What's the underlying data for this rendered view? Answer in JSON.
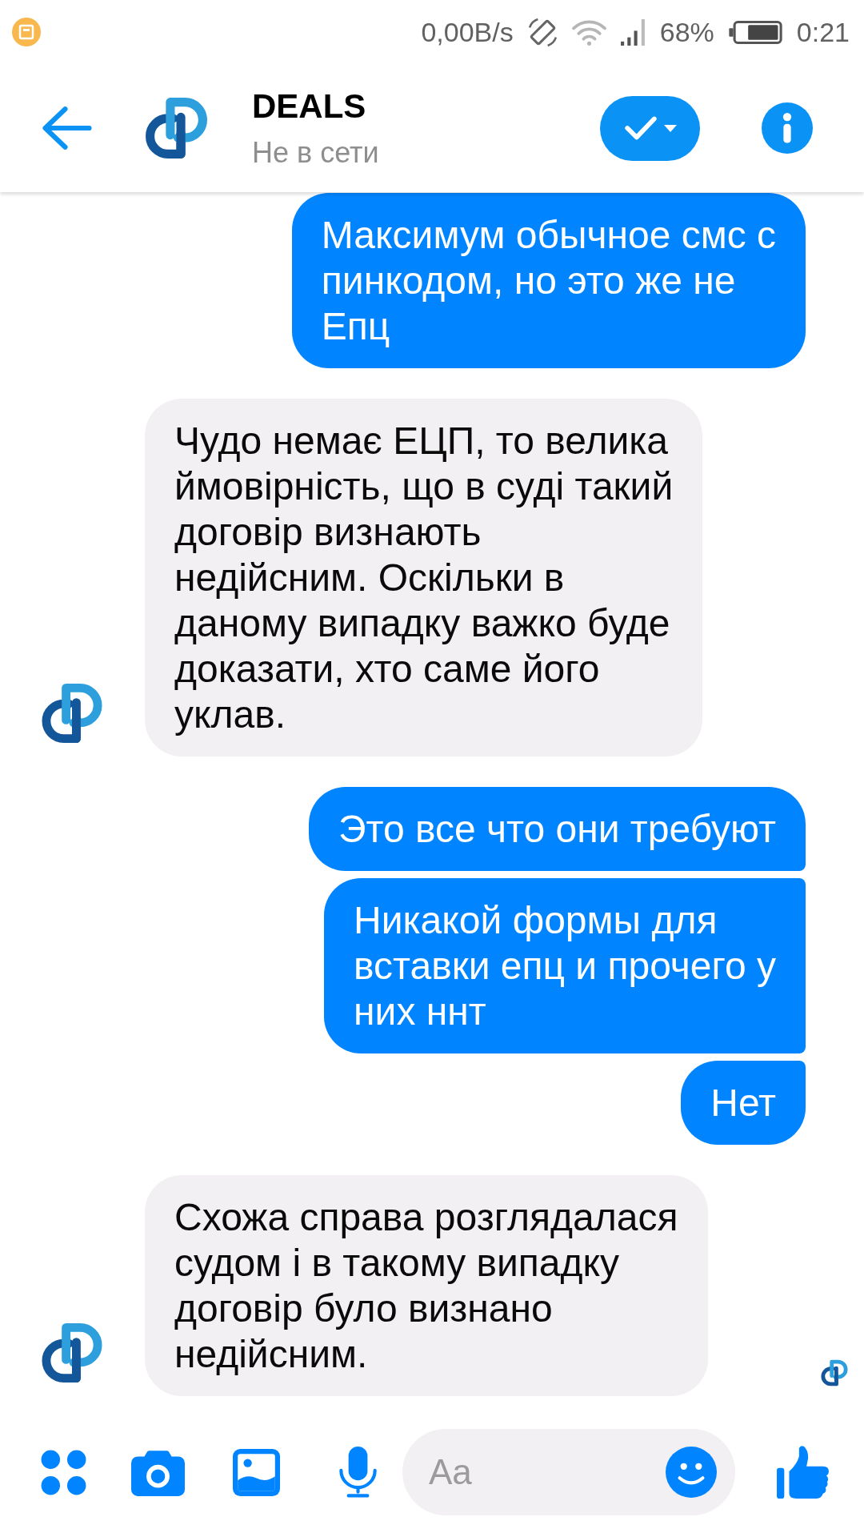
{
  "status_bar": {
    "network_speed": "0,00B/s",
    "battery": "68%",
    "time": "0:21"
  },
  "header": {
    "title": "DEALS",
    "subtitle": "Не в сети"
  },
  "messages": [
    {
      "kind": "outgoing",
      "lines": [
        "Максимум обычное смс с",
        "пинкодом, но это же не",
        "Епц"
      ],
      "seen": false
    },
    {
      "kind": "incoming",
      "lines": [
        "Чудо немає ЕЦП, то велика",
        "ймовірність, що в суді такий",
        "договір визнають",
        "недійсним. Оскільки в",
        "даному випадку важко буде",
        "доказати, хто саме його",
        "уклав."
      ],
      "seen": false
    },
    {
      "kind": "outgoing",
      "lines": [
        "Это все что они требуют"
      ],
      "seen": false
    },
    {
      "kind": "outgoing",
      "lines": [
        "Никакой формы для",
        "вставки епц и прочего у",
        "них ннт"
      ],
      "seen": false
    },
    {
      "kind": "outgoing",
      "lines": [
        "Нет"
      ],
      "seen": false
    },
    {
      "kind": "incoming",
      "lines": [
        "Схожа справа розглядалася",
        "судом і в такому випадку",
        "договір було визнано",
        "недійсним."
      ],
      "seen": true
    }
  ],
  "composer": {
    "placeholder": "Aa"
  }
}
